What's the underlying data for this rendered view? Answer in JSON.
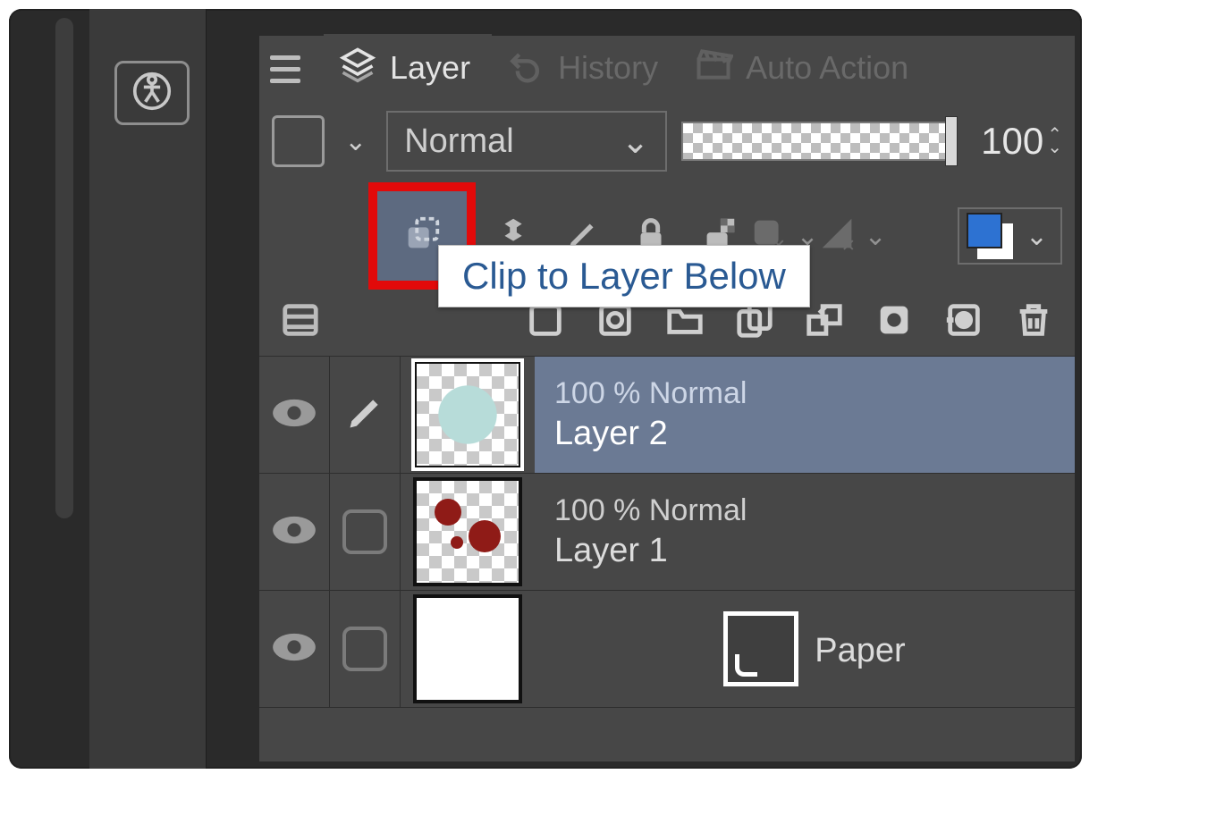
{
  "tabs": {
    "layer": "Layer",
    "history": "History",
    "auto_action": "Auto Action"
  },
  "blend": {
    "mode": "Normal",
    "opacity_value": "100"
  },
  "tooltip": "Clip to Layer Below",
  "layers": [
    {
      "opacity_text": "100 % Normal",
      "name": "Layer 2",
      "selected": true,
      "editing": true,
      "thumb": "teal"
    },
    {
      "opacity_text": "100 % Normal",
      "name": "Layer 1",
      "selected": false,
      "editing": false,
      "thumb": "dots"
    },
    {
      "opacity_text": "",
      "name": "Paper",
      "selected": false,
      "editing": false,
      "thumb": "paper"
    }
  ]
}
